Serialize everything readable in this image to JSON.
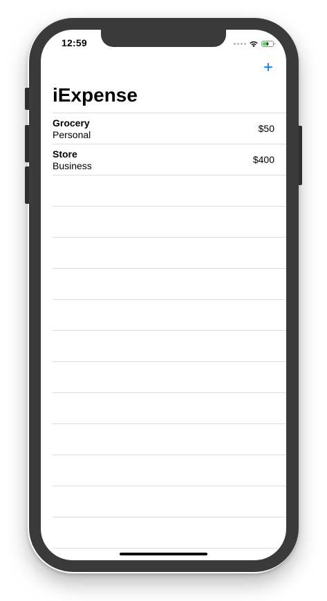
{
  "status_bar": {
    "time": "12:59",
    "wifi_icon": "wifi-icon",
    "battery_icon": "battery-charging-icon",
    "battery_color": "#4cd964"
  },
  "nav": {
    "title": "iExpense",
    "add_button_label": "+",
    "accent_color": "#007aff"
  },
  "expenses": [
    {
      "name": "Grocery",
      "type": "Personal",
      "amount": "$50"
    },
    {
      "name": "Store",
      "type": "Business",
      "amount": "$400"
    }
  ]
}
